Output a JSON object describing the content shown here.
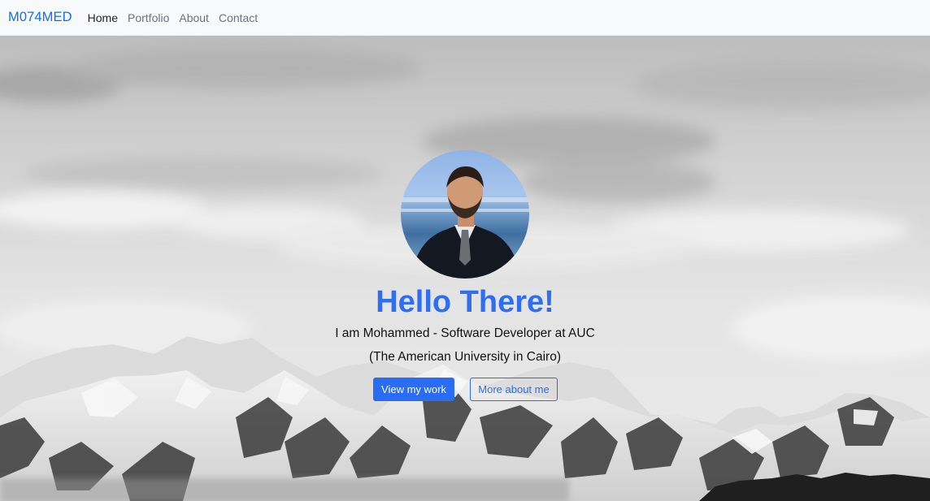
{
  "navbar": {
    "brand": "M074MED",
    "links": [
      {
        "label": "Home",
        "active": true
      },
      {
        "label": "Portfolio",
        "active": false
      },
      {
        "label": "About",
        "active": false
      },
      {
        "label": "Contact",
        "active": false
      }
    ]
  },
  "hero": {
    "background": "snow-mountains-photo",
    "avatar": "profile-photo",
    "headline": "Hello There!",
    "tagline": "I am Mohammed - Software Developer at AUC (The American University in Cairo)",
    "buttons": {
      "primary": "View my work",
      "secondary": "More about me"
    }
  },
  "colors": {
    "accent": "#2b6cf5",
    "brand": "#0d6efd",
    "navbar_bg": "#f8f9fa"
  }
}
